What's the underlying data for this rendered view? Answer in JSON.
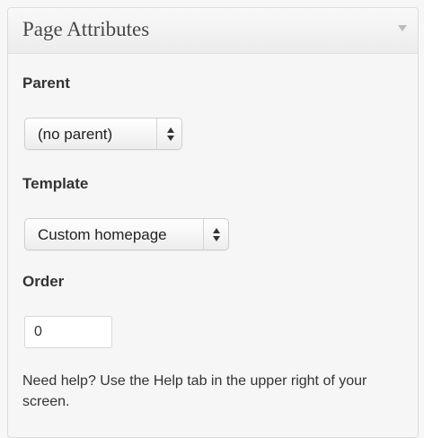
{
  "panel": {
    "title": "Page Attributes"
  },
  "parent": {
    "label": "Parent",
    "selected": "(no parent)"
  },
  "template": {
    "label": "Template",
    "selected": "Custom homepage"
  },
  "order": {
    "label": "Order",
    "value": "0"
  },
  "help": {
    "text": "Need help? Use the Help tab in the upper right of your screen."
  },
  "icons": {
    "toggle": "triangle-down-icon",
    "select": "up-down-arrows-icon"
  }
}
